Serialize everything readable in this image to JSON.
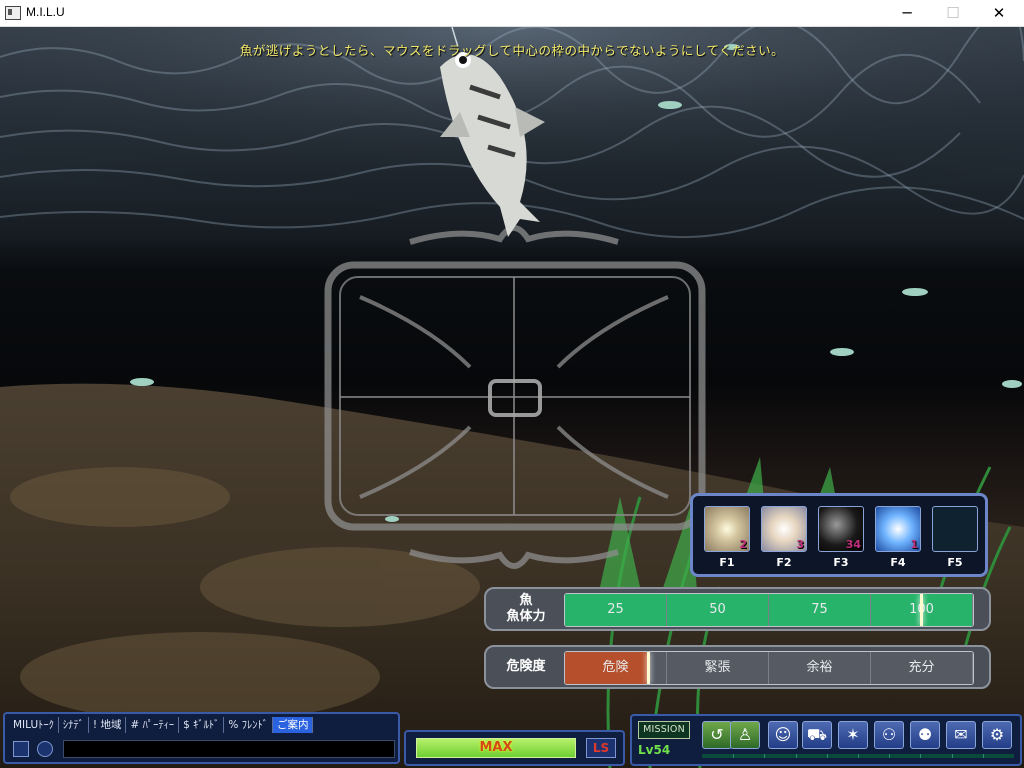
{
  "window": {
    "title": "M.I.L.U",
    "minimize": "─",
    "maximize": "☐",
    "close": "✕"
  },
  "instruction": "魚が逃げようとしたら、マウスをドラッグして中心の枠の中からでないようにしてください。",
  "skills": [
    {
      "key": "F1",
      "count": "2",
      "icon": "sparkle-orb-icon"
    },
    {
      "key": "F2",
      "count": "3",
      "icon": "glow-orb-icon"
    },
    {
      "key": "F3",
      "count": "34",
      "icon": "black-orb-icon"
    },
    {
      "key": "F4",
      "count": "1",
      "icon": "globe-orb-icon"
    },
    {
      "key": "F5",
      "count": "",
      "icon": "empty-slot"
    }
  ],
  "fish_stamina": {
    "label_line1": "魚",
    "label_line2": "魚体力",
    "segments": [
      "25",
      "50",
      "75",
      "100"
    ],
    "current_fraction": 0.87
  },
  "danger": {
    "label": "危険度",
    "segments": [
      "危険",
      "緊張",
      "余裕",
      "充分"
    ],
    "current_fraction": 0.2
  },
  "chat": {
    "tabs": [
      "MILUﾄｰｸ",
      "ｼﾅﾃﾞ",
      "! 地域",
      "# ﾊﾟｰﾃｨｰ",
      "$ ｷﾞﾙﾄﾞ",
      "% ﾌﾚﾝﾄﾞ",
      "ご案内"
    ],
    "active_tab": 6,
    "input_value": ""
  },
  "power": {
    "label": "MAX",
    "ls_label": "LS"
  },
  "menu": {
    "mission": "MISSION",
    "level": "Lv54"
  },
  "colors": {
    "stamina_green": "#27b36a",
    "danger_red": "#b6502c",
    "gauge_gray": "#555a63",
    "instruction_yellow": "#f2e96b"
  }
}
